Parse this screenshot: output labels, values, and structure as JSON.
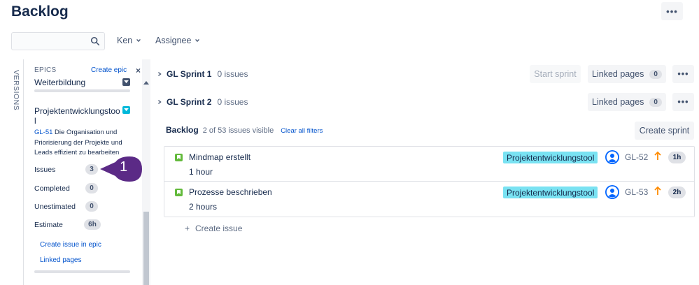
{
  "page": {
    "title": "Backlog",
    "more_label": "•••"
  },
  "filters": {
    "search_placeholder": "",
    "user_filter": "Ken",
    "assignee_filter": "Assignee"
  },
  "sidebar": {
    "versions_label": "VERSIONS",
    "epics_label": "EPICS",
    "create_epic": "Create epic",
    "close_label": "×",
    "epics": [
      {
        "name": "Weiterbildung"
      },
      {
        "name": "Projektentwicklungstool",
        "key": "GL-51",
        "description": "Die Organisation und Priorisierung der Projekte und Leads effizient zu bearbeiten",
        "stats": [
          {
            "label": "Issues",
            "value": "3"
          },
          {
            "label": "Completed",
            "value": "0"
          },
          {
            "label": "Unestimated",
            "value": "0"
          },
          {
            "label": "Estimate",
            "value": "6h"
          }
        ],
        "links": [
          "Create issue in epic",
          "Linked pages"
        ]
      }
    ],
    "callout_number": "1"
  },
  "sprints": [
    {
      "name": "GL Sprint 1",
      "count": "0 issues",
      "start_label": "Start sprint",
      "linked_label": "Linked pages",
      "linked_count": "0"
    },
    {
      "name": "GL Sprint 2",
      "count": "0 issues",
      "linked_label": "Linked pages",
      "linked_count": "0"
    }
  ],
  "backlog": {
    "title": "Backlog",
    "visible": "2 of 53 issues visible",
    "clear_filters": "Clear all filters",
    "create_sprint": "Create sprint",
    "create_issue_plus": "+",
    "create_issue": "Create issue",
    "issues": [
      {
        "summary": "Mindmap erstellt",
        "estimate_text": "1 hour",
        "epic": "Projektentwicklungstool",
        "key": "GL-52",
        "estimate": "1h"
      },
      {
        "summary": "Prozesse beschrieben",
        "estimate_text": "2 hours",
        "epic": "Projektentwicklungstool",
        "key": "GL-53",
        "estimate": "2h"
      }
    ]
  },
  "colors": {
    "epic_lozenge": "#79e2f2",
    "story": "#63ba3c",
    "priority": "#ff8b00",
    "callout": "#5b2a86",
    "link": "#0052cc"
  }
}
